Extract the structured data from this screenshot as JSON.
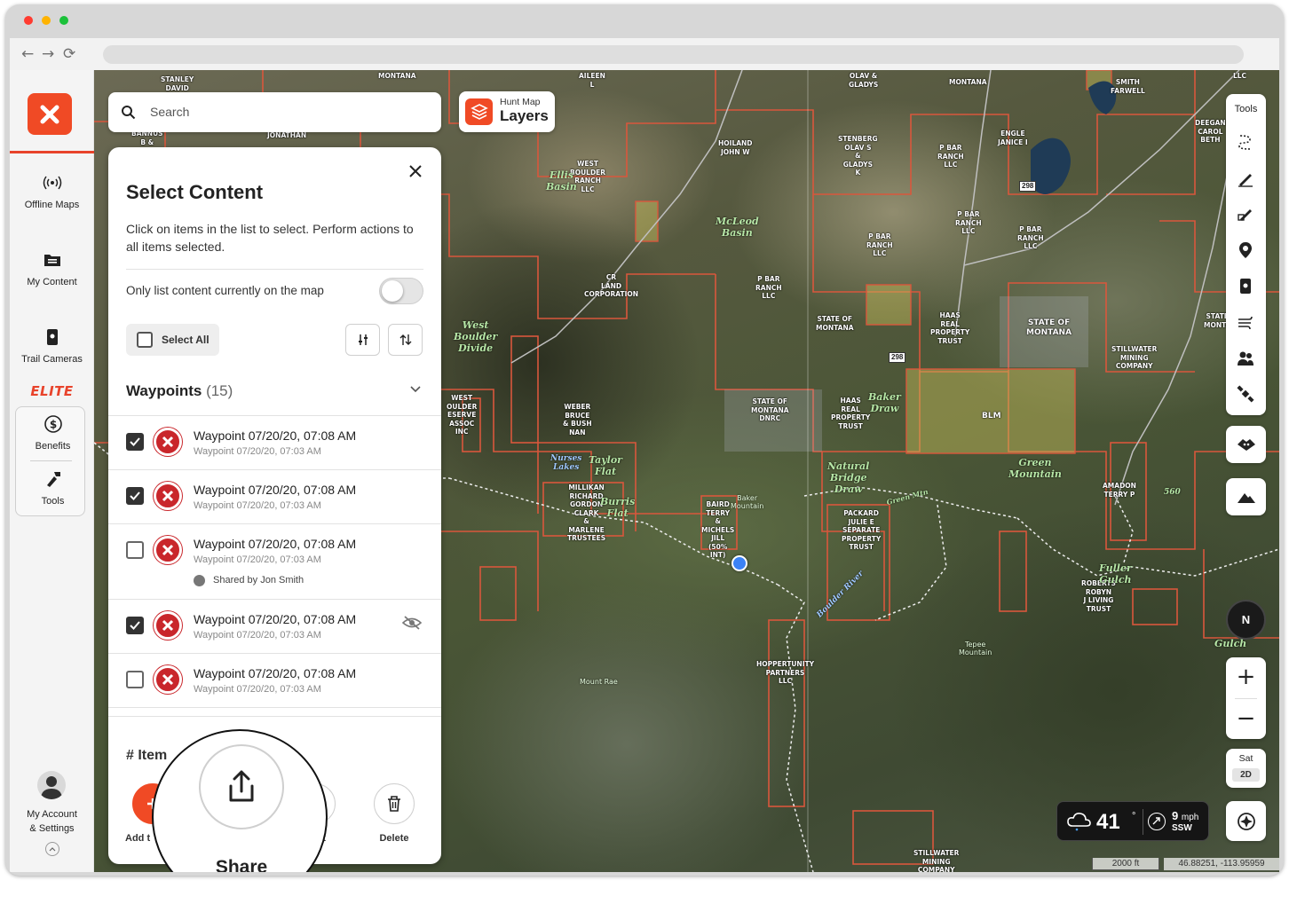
{
  "browser": {
    "nav": {
      "back": "←",
      "forward": "→",
      "reload": "⟳"
    }
  },
  "sidebar": {
    "items": [
      {
        "label": "Offline Maps",
        "icon": "offline-signal-icon"
      },
      {
        "label": "My Content",
        "icon": "folder-list-icon"
      },
      {
        "label": "Trail Cameras",
        "icon": "trail-camera-icon"
      }
    ],
    "elite_label": "ELITE",
    "elite_items": [
      {
        "label": "Benefits",
        "icon": "dollar-icon"
      },
      {
        "label": "Tools",
        "icon": "tools-icon"
      }
    ],
    "account_label_1": "My Account",
    "account_label_2": "& Settings"
  },
  "search": {
    "placeholder": "Search"
  },
  "layers": {
    "small": "Hunt Map",
    "big": "Layers"
  },
  "panel": {
    "title": "Select Content",
    "description": "Click on items in the list to select. Perform actions to all items selected.",
    "toggle_label": "Only list content currently on the map",
    "toggle_on": false,
    "select_all_label": "Select All",
    "section_title": "Waypoints",
    "section_count": "(15)",
    "waypoints": [
      {
        "title": "Waypoint 07/20/20, 07:08 AM",
        "subtitle": "Waypoint 07/20/20, 07:03 AM",
        "checked": true
      },
      {
        "title": "Waypoint 07/20/20, 07:08 AM",
        "subtitle": "Waypoint 07/20/20, 07:03 AM",
        "checked": true
      },
      {
        "title": "Waypoint 07/20/20, 07:08 AM",
        "subtitle": "Waypoint 07/20/20, 07:03 AM",
        "checked": false,
        "shared": "Shared by Jon Smith"
      },
      {
        "title": "Waypoint 07/20/20, 07:08 AM",
        "subtitle": "Waypoint 07/20/20, 07:03 AM",
        "checked": true,
        "hidden": true
      },
      {
        "title": "Waypoint 07/20/20, 07:08 AM",
        "subtitle": "Waypoint 07/20/20, 07:03 AM",
        "checked": false
      }
    ],
    "items_label": "# Item",
    "actions": {
      "add_label": "Add t",
      "export_label": "rt",
      "delete_label": "Delete"
    }
  },
  "callout": {
    "label": "Share"
  },
  "tools": {
    "label": "Tools"
  },
  "compass": {
    "label": "N"
  },
  "zoom": {
    "in": "+",
    "out": "−"
  },
  "basemap": {
    "label": "Sat",
    "mode": "2D"
  },
  "weather": {
    "temp": "41",
    "deg": "°",
    "wind_speed": "9",
    "wind_unit": "mph",
    "wind_dir": "SSW"
  },
  "scale": "2000 ft",
  "coordinates": "46.88251, -113.95959",
  "map": {
    "labels": [
      "STANLEY\nDAVID",
      "MONTANA",
      "AILEEN\nL",
      "OLAV &\nGLADYS",
      "MONTANA",
      "SMITH\nFARWELL",
      "LLC",
      "BANNUS\nB &",
      "JONATHAN",
      "HOILAND\nJOHN W",
      "STENBERG\nOLAV S\n&\nGLADYS\nK",
      "P BAR\nRANCH\nLLC",
      "ENGLE\nJANICE I",
      "DEEGAN\nCAROL\nBETH",
      "WEST\nBOULDER\nRANCH\nLLC",
      "P BAR\nRANCH\nLLC",
      "P BAR\nRANCH\nLLC",
      "P BAR\nRANCH\nLLC",
      "CR\nLAND\nCORPORATION",
      "P BAR\nRANCH\nLLC",
      "STATE OF\nMONTANA",
      "HAAS\nREAL\nPROPERTY\nTRUST",
      "STATE OF\nMONTANA",
      "STILLWATER\nMINING\nCOMPANY",
      "STATE\nMONTA",
      "WEST\nOULDER\nESERVE\nASSOC\nINC",
      "WEBER\nBRUCE\n& BUSH\nNAN",
      "STATE OF\nMONTANA\nDNRC",
      "HAAS\nREAL\nPROPERTY\nTRUST",
      "BLM",
      "AMADON\nTERRY P",
      "MILLIKAN\nRICHARD\nGORDON\nCLARK\n&\nMARLENE\nTRUSTEES",
      "BAIRD\nTERRY\n&\nMICHELS\nJILL\n(50%\nINT)",
      "PACKARD\nJULIE E\nSEPARATE\nPROPERTY\nTRUST",
      "ROBERTS\nROBYN\nJ LIVING\nTRUST",
      "HOPPERTUNITY\nPARTNERS\nLLC",
      "STILLWATER\nMINING\nCOMPANY"
    ],
    "places": [
      "Ellis\nBasin",
      "McLeod\nBasin",
      "West\nBoulder\nDivide",
      "Taylor\nFlat",
      "Nurses\nLakes",
      "Burris\nFlat",
      "Baker\nDraw",
      "Natural\nBridge\nDraw",
      "Green\nMountain",
      "Baker\nMountain",
      "Tepee\nMountain",
      "Mount Rae",
      "Boulder River",
      "Green Mtn",
      "Fuller\nGulch",
      "Gulch",
      "560"
    ],
    "road_badges": [
      "298",
      "298"
    ]
  }
}
